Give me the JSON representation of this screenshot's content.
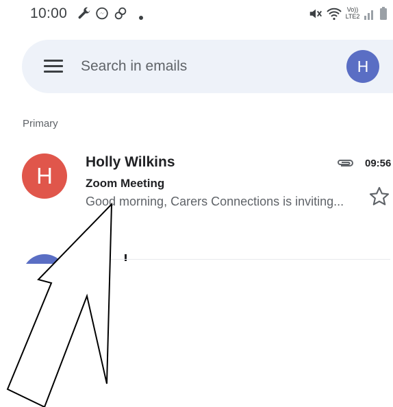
{
  "status_bar": {
    "time": "10:00",
    "left_icons": [
      "wrench-icon",
      "messenger-icon",
      "link-icon",
      "dot-icon"
    ],
    "right_icons": [
      "mute-icon",
      "wifi-icon",
      "volte-icon",
      "signal-icon",
      "battery-icon"
    ],
    "volte_label_top": "Vo))",
    "volte_label_bottom": "LTE2"
  },
  "search": {
    "placeholder": "Search in emails",
    "account_initial": "H",
    "account_color": "#5a6ec4"
  },
  "section": {
    "label": "Primary"
  },
  "emails": [
    {
      "avatar_initial": "H",
      "avatar_color": "#e0564b",
      "sender": "Holly Wilkins",
      "subject": "Zoom Meeting",
      "snippet": "Good morning, Carers Connections is inviting...",
      "time": "09:56",
      "has_attachment": true,
      "starred": false
    }
  ],
  "next_email": {
    "avatar_color": "#5a6ec4"
  },
  "overlay": {
    "arrow_color": "#000000",
    "arrow_fill": "#ffffff"
  }
}
